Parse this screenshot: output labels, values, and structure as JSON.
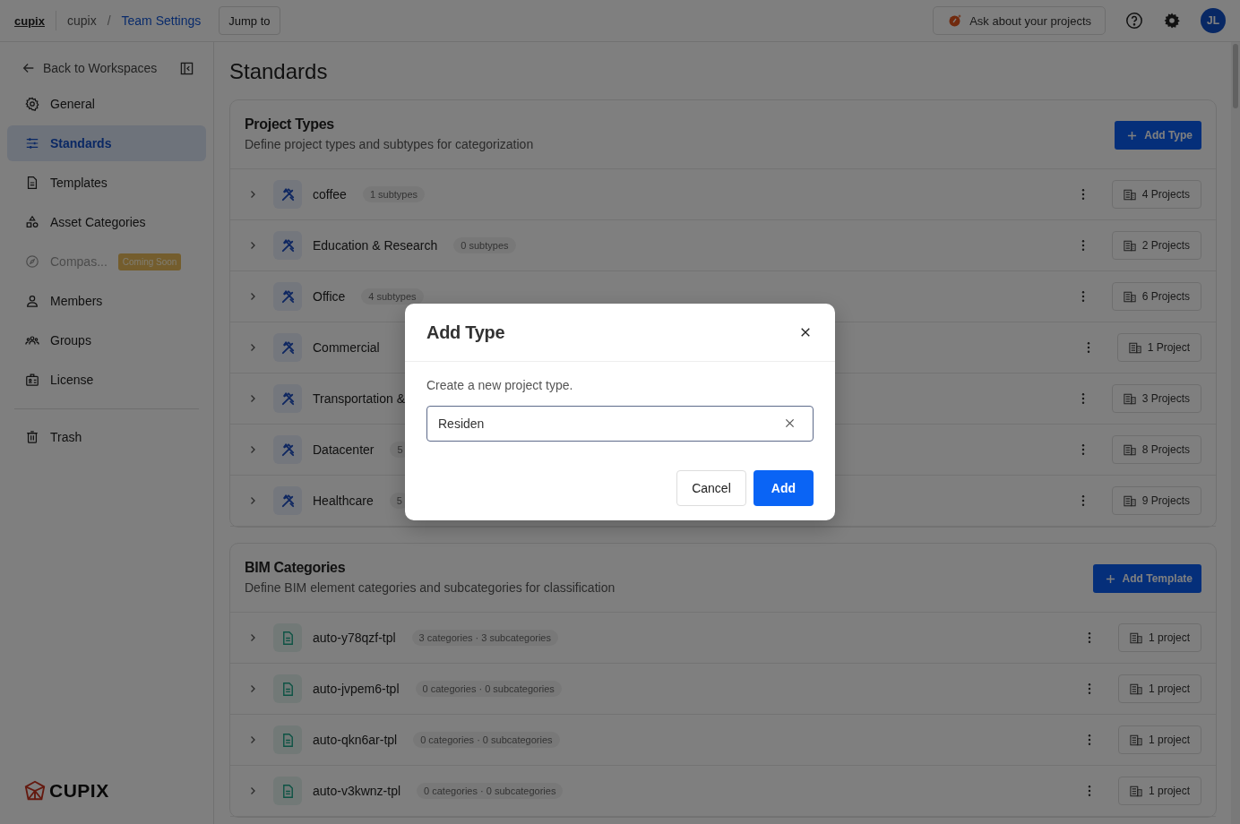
{
  "topbar": {
    "logo": "cupix",
    "breadcrumb": [
      "cupix",
      "Team Settings"
    ],
    "separator": "/",
    "jump_button": "Jump to",
    "ask_button": "Ask about your projects",
    "avatar": "JL"
  },
  "sidebar": {
    "back": "Back to Workspaces",
    "items": [
      {
        "label": "General",
        "kind": "gear",
        "selected": false,
        "disabled": false
      },
      {
        "label": "Standards",
        "kind": "sliders",
        "selected": true,
        "disabled": false
      },
      {
        "label": "Templates",
        "kind": "document",
        "selected": false,
        "disabled": false
      },
      {
        "label": "Asset Categories",
        "kind": "shapes",
        "selected": false,
        "disabled": false
      },
      {
        "label": "Compas...",
        "kind": "compass",
        "selected": false,
        "disabled": true,
        "badge": "Coming Soon"
      },
      {
        "label": "Members",
        "kind": "person",
        "selected": false,
        "disabled": false
      },
      {
        "label": "Groups",
        "kind": "group",
        "selected": false,
        "disabled": false
      },
      {
        "label": "License",
        "kind": "badge",
        "selected": false,
        "disabled": false
      }
    ],
    "footer_items": [
      {
        "label": "Trash",
        "kind": "trash",
        "selected": false,
        "disabled": false
      }
    ],
    "brand": "CUPIX"
  },
  "page_title": "Standards",
  "sections": [
    {
      "title": "Project Types",
      "description": "Define project types and subtypes for categorization",
      "button": "Add Type",
      "kind": "tools",
      "rows": [
        {
          "name": "coffee",
          "badge": "1 subtypes",
          "projects": "4 Projects"
        },
        {
          "name": "Education & Research",
          "badge": "0 subtypes",
          "projects": "2 Projects"
        },
        {
          "name": "Office",
          "badge": "4 subtypes",
          "projects": "6 Projects"
        },
        {
          "name": "Commercial",
          "projects": "1 Project"
        },
        {
          "name": "Transportation &",
          "projects": "3 Projects"
        },
        {
          "name": "Datacenter",
          "badge": "5",
          "projects": "8 Projects"
        },
        {
          "name": "Healthcare",
          "badge": "5",
          "projects": "9 Projects"
        }
      ]
    },
    {
      "title": "BIM Categories",
      "description": "Define BIM element categories and subcategories for classification",
      "button": "Add Template",
      "kind": "document",
      "rows": [
        {
          "name": "auto-y78qzf-tpl",
          "badge": "3 categories · 3 subcategories",
          "projects": "1 project"
        },
        {
          "name": "auto-jvpem6-tpl",
          "badge": "0 categories · 0 subcategories",
          "projects": "1 project"
        },
        {
          "name": "auto-qkn6ar-tpl",
          "badge": "0 categories · 0 subcategories",
          "projects": "1 project"
        },
        {
          "name": "auto-v3kwnz-tpl",
          "badge": "0 categories · 0 subcategories",
          "projects": "1 project"
        }
      ]
    }
  ],
  "modal": {
    "title": "Add Type",
    "description": "Create a new project type.",
    "value": "Residen",
    "cancel": "Cancel",
    "confirm": "Add"
  }
}
